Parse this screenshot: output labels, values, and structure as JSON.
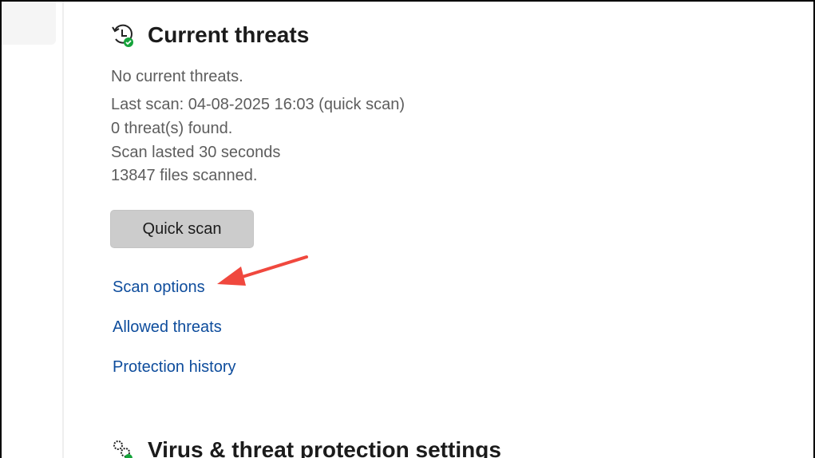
{
  "current_threats": {
    "title": "Current threats",
    "status": "No current threats.",
    "last_scan": "Last scan: 04-08-2025 16:03 (quick scan)",
    "threats_found": "0 threat(s) found.",
    "duration": "Scan lasted 30 seconds",
    "files": "13847 files scanned.",
    "quick_scan": "Quick scan",
    "links": [
      "Scan options",
      "Allowed threats",
      "Protection history"
    ]
  },
  "settings": {
    "title": "Virus & threat protection settings"
  },
  "colors": {
    "link": "#0d4c9c",
    "arrow": "#f0483e",
    "check": "#15a33a"
  }
}
